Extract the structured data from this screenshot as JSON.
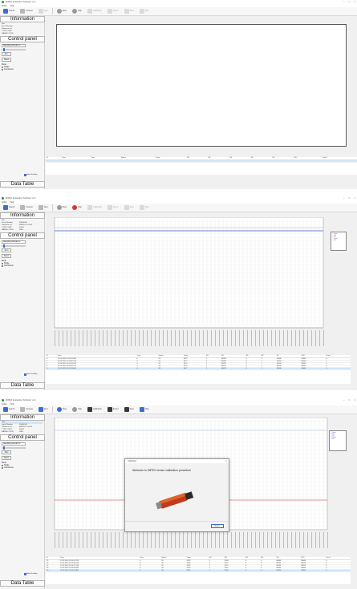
{
  "app": {
    "title": "MIPEX Evaluation Software v1.4",
    "menu": [
      "Action",
      "Help"
    ],
    "toolbar": [
      {
        "label": "Search",
        "icon": "search-icon"
      },
      {
        "label": "Connect",
        "icon": "plug-icon"
      },
      {
        "label": "Next",
        "icon": "next-icon"
      },
      {
        "label": "Open",
        "icon": "open-icon"
      },
      {
        "label": "Stop",
        "icon": "stop-icon"
      },
      {
        "label": "Calibration",
        "icon": "calibration-icon"
      },
      {
        "label": "Export",
        "icon": "export-icon"
      },
      {
        "label": "Save",
        "icon": "save-icon"
      },
      {
        "label": "Help",
        "icon": "help-icon"
      }
    ]
  },
  "left": {
    "information_title": "Information",
    "info_rows": [
      {
        "k": "Port",
        "v": ""
      },
      {
        "k": "Serial Number",
        "v": "20000000"
      },
      {
        "k": "Firmware rev.",
        "v": "MIPEX-2-v14-03"
      },
      {
        "k": "TYPE CODE",
        "v": "04L01"
      },
      {
        "k": "RANGE CODE",
        "v": "3000"
      }
    ],
    "control_title": "Control panel",
    "sampling_label": "Sampling interval",
    "sampling_value": "1 s",
    "start_label": "Start",
    "zero_label": "Zero",
    "reset_label": "Reset",
    "mode_label": "Mode",
    "mode_options": [
      "Single",
      "Continuous"
    ],
    "data_table_title": "Data Table",
    "autoscroll_label": "Auto Scrolling"
  },
  "table": {
    "columns": [
      "N",
      "Time",
      "Conc",
      "Status",
      "Temp",
      "SS",
      "SR",
      "SS",
      "SR",
      "SU",
      "CRC",
      "Conc2"
    ],
    "rows_shot2": [
      [
        "1",
        "12.05.2019 11:26:29.634",
        "0",
        "99",
        "0979",
        "1",
        "40280",
        "0",
        "1",
        "30000",
        "30000",
        "0"
      ],
      [
        "2",
        "12.05.2019 11:26:30.134",
        "0",
        "99",
        "0977",
        "1",
        "40280",
        "0",
        "1",
        "30000",
        "30000",
        "0"
      ],
      [
        "3",
        "12.05.2019 11:26:31.004",
        "0",
        "99",
        "0975",
        "1",
        "40278",
        "0",
        "1",
        "30000",
        "30000",
        "0"
      ],
      [
        "4",
        "12.05.2019 11:26:32.074",
        "0",
        "99",
        "0979",
        "1",
        "40276",
        "0",
        "1",
        "30000",
        "30000",
        "0"
      ],
      [
        "5",
        "12.05.2019 11:26:33.094",
        "0",
        "99",
        "0977",
        "1",
        "40276",
        "0",
        "1",
        "30000",
        "30000",
        "0"
      ]
    ],
    "rows_shot3": [
      [
        "15",
        "12.05.2019 11:30:55.224",
        "0",
        "99",
        "0978",
        "1",
        "5208",
        "0",
        "0",
        "30000",
        "30000",
        "0"
      ],
      [
        "16",
        "12.05.2019 11:30:56.244",
        "0",
        "99",
        "0978",
        "1",
        "5212",
        "0",
        "0",
        "30000",
        "30000",
        "0"
      ],
      [
        "17",
        "12.05.2019 11:30:57.264",
        "0",
        "99",
        "0978",
        "1",
        "5210",
        "0",
        "0",
        "30000",
        "30000",
        "0"
      ],
      [
        "18",
        "12.05.2019 11:30:58.284",
        "0",
        "99",
        "0979",
        "1",
        "5212",
        "0",
        "0",
        "30000",
        "30000",
        "0"
      ],
      [
        "19",
        "12.05.2019 11:30:59.304",
        "0",
        "99",
        "0979",
        "1",
        "5210",
        "0",
        "0",
        "30000",
        "30000",
        "0"
      ]
    ]
  },
  "dialog": {
    "title": "Calibration",
    "message": "Welcome to MIPEX sensor calibration procedure",
    "next_label": "Next >",
    "close_glyph": "×"
  },
  "legend": {
    "items": [
      "Conc",
      "SS",
      "SR",
      "Temp",
      "SU"
    ],
    "colors": [
      "#1a3fb5",
      "#d12a2a",
      "#2a9a2a",
      "#8a2ab5",
      "#555555"
    ]
  },
  "colors": {
    "accent": "#3b6fd0",
    "selected_row": "#cfe6fb",
    "series_blue": "#3a55c8",
    "series_red": "#d12a2a",
    "series_light": "#9fb4e8"
  }
}
